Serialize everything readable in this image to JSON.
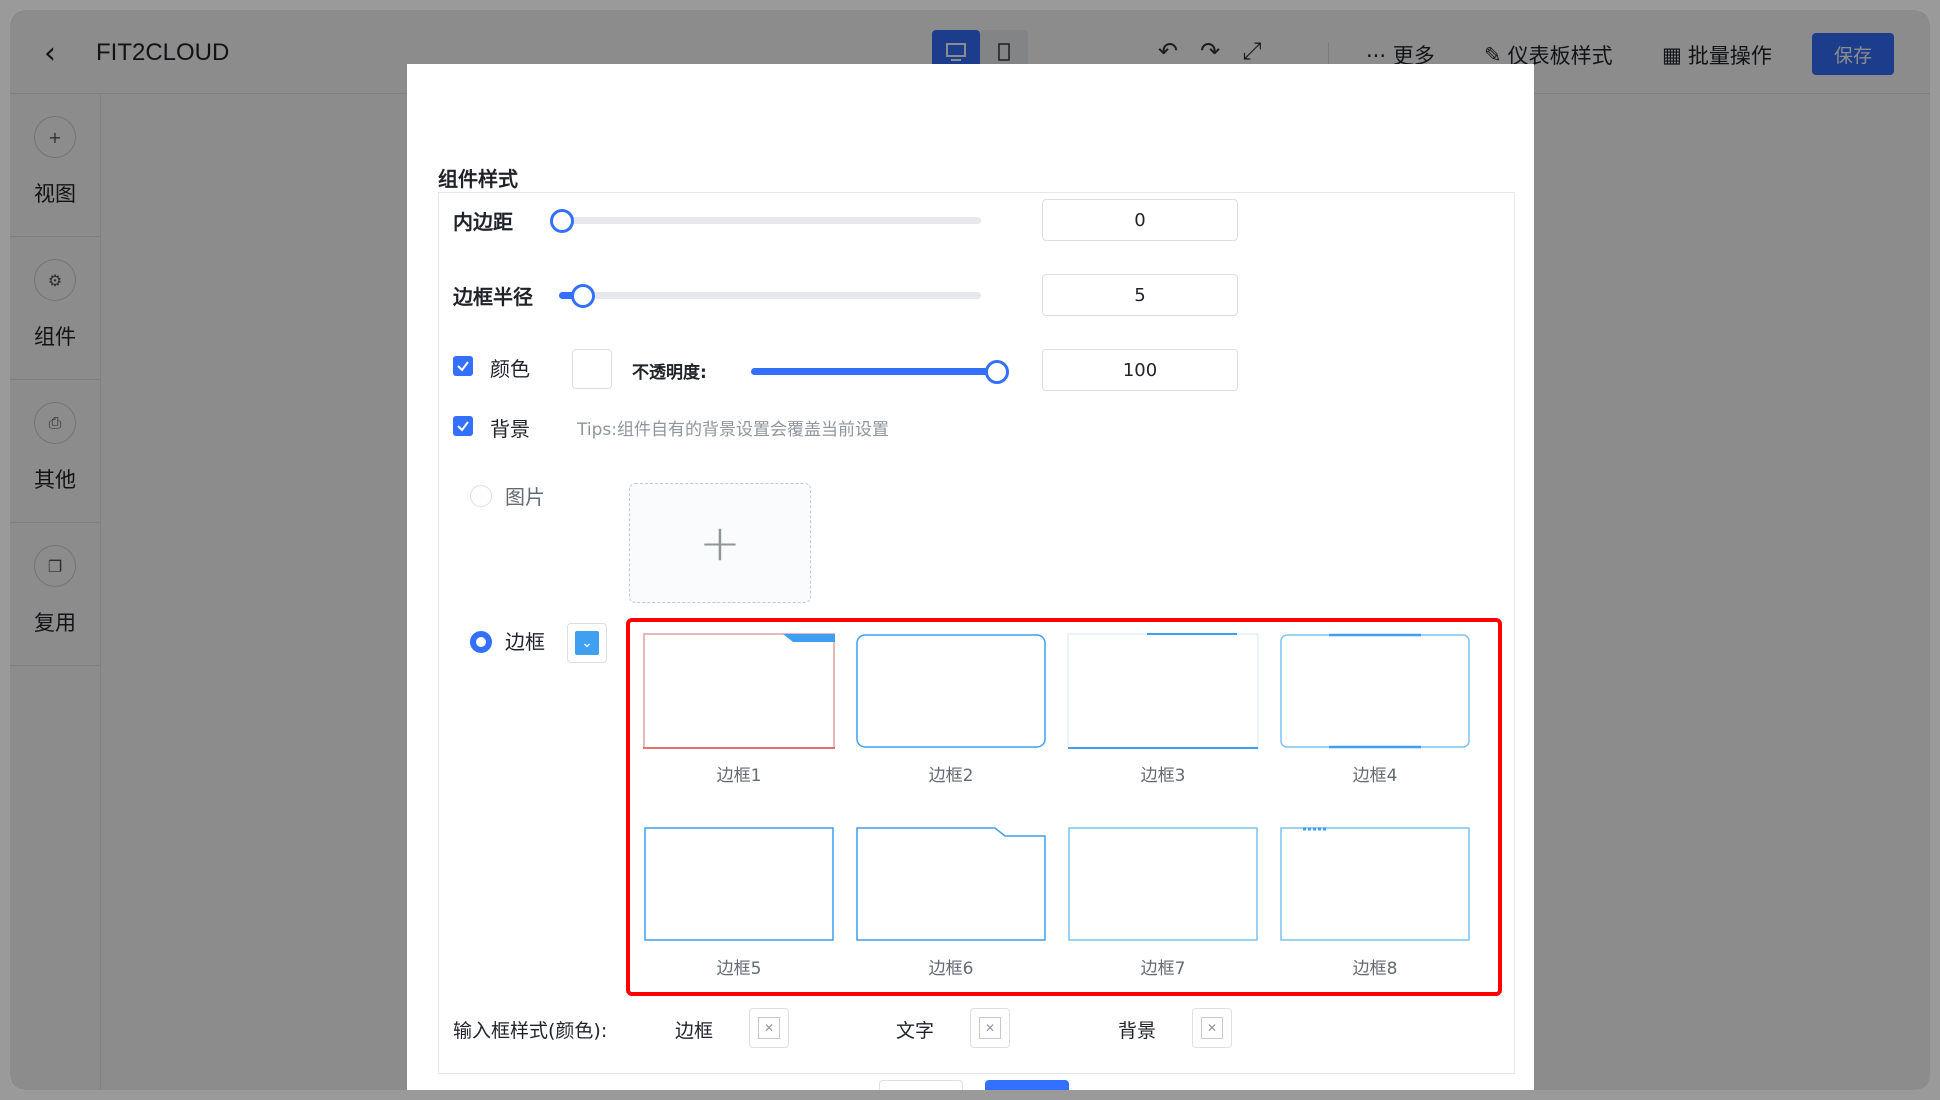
{
  "app": {
    "title": "FIT2CLOUD",
    "back_icon": "chevron-left-icon"
  },
  "toolbar": {
    "more": "··· 更多",
    "dashboard_style": "仪表板样式",
    "batch": "批量操作",
    "save": "保存"
  },
  "rail": {
    "items": [
      {
        "label": "视图",
        "icon": "plus-circle-icon"
      },
      {
        "label": "组件",
        "icon": "gear-icon"
      },
      {
        "label": "其他",
        "icon": "printer-icon"
      },
      {
        "label": "复用",
        "icon": "copy-icon"
      }
    ]
  },
  "dialog": {
    "section_title": "组件样式",
    "padding": {
      "label": "内边距",
      "value": "0",
      "fraction": 0
    },
    "radius": {
      "label": "边框半径",
      "value": "5",
      "fraction": 0.05
    },
    "color": {
      "label": "颜色",
      "checked": true,
      "opacity_label": "不透明度:",
      "opacity_value": "100",
      "opacity_fraction": 1
    },
    "background": {
      "label": "背景",
      "checked": true,
      "tips": "Tips:组件自有的背景设置会覆盖当前设置"
    },
    "image_option": {
      "label": "图片",
      "selected": false
    },
    "border_option": {
      "label": "边框",
      "selected": true
    },
    "frames": [
      {
        "label": "边框1"
      },
      {
        "label": "边框2"
      },
      {
        "label": "边框3"
      },
      {
        "label": "边框4"
      },
      {
        "label": "边框5"
      },
      {
        "label": "边框6"
      },
      {
        "label": "边框7"
      },
      {
        "label": "边框8"
      }
    ],
    "input_style": {
      "label": "输入框样式(颜色):",
      "border": "边框",
      "text": "文字",
      "background": "背景"
    }
  },
  "colors": {
    "accent": "#3370ff",
    "frame_blue": "#3f9ff0",
    "highlight": "#ff0000"
  }
}
